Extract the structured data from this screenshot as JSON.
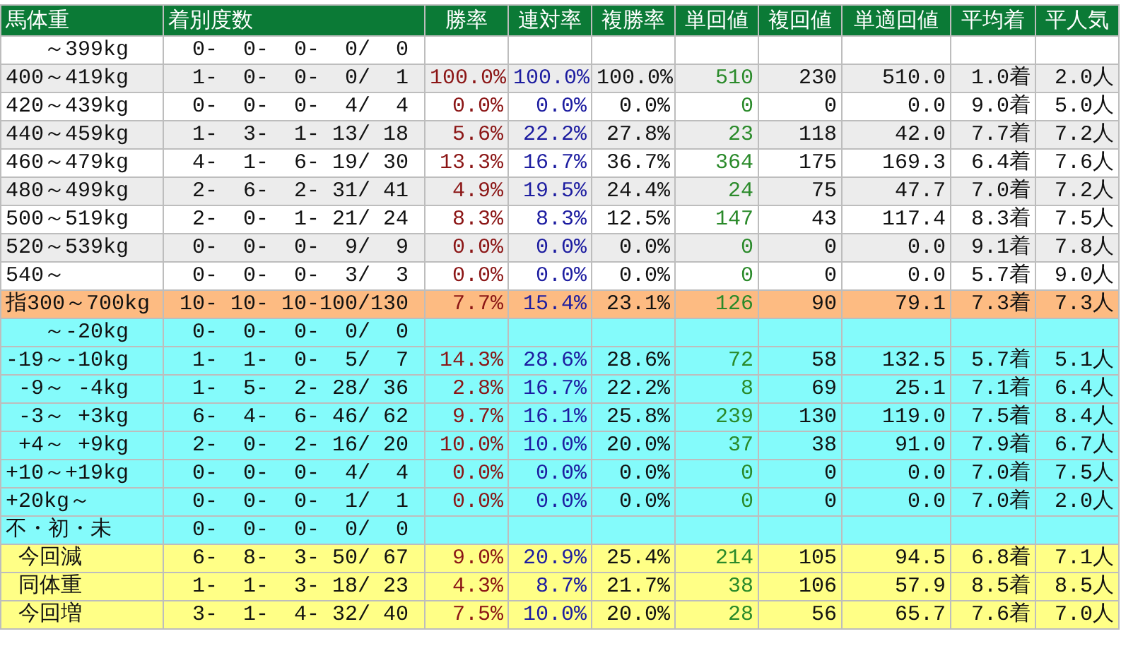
{
  "table": {
    "columns": [
      "馬体重",
      "着別度数",
      "勝率",
      "連対率",
      "複勝率",
      "単回値",
      "複回値",
      "単適回値",
      "平均着",
      "平人気"
    ],
    "rows": [
      {
        "kind": "weight",
        "label": "   ～399kg",
        "record": " 0-  0-  0-  0/  0"
      },
      {
        "kind": "weight",
        "label": "400～419kg",
        "record": " 1-  0-  0-  0/  1",
        "stats": [
          "100.0%",
          "100.0%",
          "100.0%",
          "510",
          "230",
          "510.0",
          "1.0着",
          "2.0人"
        ]
      },
      {
        "kind": "weight",
        "label": "420～439kg",
        "record": " 0-  0-  0-  4/  4",
        "stats": [
          "0.0%",
          "0.0%",
          "0.0%",
          "0",
          "0",
          "0.0",
          "9.0着",
          "5.0人"
        ]
      },
      {
        "kind": "weight",
        "label": "440～459kg",
        "record": " 1-  3-  1- 13/ 18",
        "stats": [
          "5.6%",
          "22.2%",
          "27.8%",
          "23",
          "118",
          "42.0",
          "7.7着",
          "7.2人"
        ]
      },
      {
        "kind": "weight",
        "label": "460～479kg",
        "record": " 4-  1-  6- 19/ 30",
        "stats": [
          "13.3%",
          "16.7%",
          "36.7%",
          "364",
          "175",
          "169.3",
          "6.4着",
          "7.6人"
        ]
      },
      {
        "kind": "weight",
        "label": "480～499kg",
        "record": " 2-  6-  2- 31/ 41",
        "stats": [
          "4.9%",
          "19.5%",
          "24.4%",
          "24",
          "75",
          "47.7",
          "7.0着",
          "7.2人"
        ]
      },
      {
        "kind": "weight",
        "label": "500～519kg",
        "record": " 2-  0-  1- 21/ 24",
        "stats": [
          "8.3%",
          "8.3%",
          "12.5%",
          "147",
          "43",
          "117.4",
          "8.3着",
          "7.5人"
        ]
      },
      {
        "kind": "weight",
        "label": "520～539kg",
        "record": " 0-  0-  0-  9/  9",
        "stats": [
          "0.0%",
          "0.0%",
          "0.0%",
          "0",
          "0",
          "0.0",
          "9.1着",
          "7.8人"
        ]
      },
      {
        "kind": "weight",
        "label": "540～",
        "record": " 0-  0-  0-  3/  3",
        "stats": [
          "0.0%",
          "0.0%",
          "0.0%",
          "0",
          "0",
          "0.0",
          "5.7着",
          "9.0人"
        ]
      },
      {
        "kind": "total",
        "label": "指300～700kg",
        "record": "10- 10- 10-100/130",
        "stats": [
          "7.7%",
          "15.4%",
          "23.1%",
          "126",
          "90",
          "79.1",
          "7.3着",
          "7.3人"
        ]
      },
      {
        "kind": "change",
        "label": "   ～-20kg",
        "record": " 0-  0-  0-  0/  0"
      },
      {
        "kind": "change",
        "label": "-19～-10kg",
        "record": " 1-  1-  0-  5/  7",
        "stats": [
          "14.3%",
          "28.6%",
          "28.6%",
          "72",
          "58",
          "132.5",
          "5.7着",
          "5.1人"
        ]
      },
      {
        "kind": "change",
        "label": " -9～ -4kg",
        "record": " 1-  5-  2- 28/ 36",
        "stats": [
          "2.8%",
          "16.7%",
          "22.2%",
          "8",
          "69",
          "25.1",
          "7.1着",
          "6.4人"
        ]
      },
      {
        "kind": "change",
        "label": " -3～ +3kg",
        "record": " 6-  4-  6- 46/ 62",
        "stats": [
          "9.7%",
          "16.1%",
          "25.8%",
          "239",
          "130",
          "119.0",
          "7.5着",
          "8.4人"
        ]
      },
      {
        "kind": "change",
        "label": " +4～ +9kg",
        "record": " 2-  0-  2- 16/ 20",
        "stats": [
          "10.0%",
          "10.0%",
          "20.0%",
          "37",
          "38",
          "91.0",
          "7.9着",
          "6.7人"
        ]
      },
      {
        "kind": "change",
        "label": "+10～+19kg",
        "record": " 0-  0-  0-  4/  4",
        "stats": [
          "0.0%",
          "0.0%",
          "0.0%",
          "0",
          "0",
          "0.0",
          "7.0着",
          "7.5人"
        ]
      },
      {
        "kind": "change",
        "label": "+20kg～",
        "record": " 0-  0-  0-  1/  1",
        "stats": [
          "0.0%",
          "0.0%",
          "0.0%",
          "0",
          "0",
          "0.0",
          "7.0着",
          "2.0人"
        ]
      },
      {
        "kind": "change",
        "label": "不・初・未",
        "record": " 0-  0-  0-  0/  0"
      },
      {
        "kind": "compare",
        "label": " 今回減",
        "record": " 6-  8-  3- 50/ 67",
        "stats": [
          "9.0%",
          "20.9%",
          "25.4%",
          "214",
          "105",
          "94.5",
          "6.8着",
          "7.1人"
        ]
      },
      {
        "kind": "compare",
        "label": " 同体重",
        "record": " 1-  1-  3- 18/ 23",
        "stats": [
          "4.3%",
          "8.7%",
          "21.7%",
          "38",
          "106",
          "57.9",
          "8.5着",
          "8.5人"
        ]
      },
      {
        "kind": "compare",
        "label": " 今回増",
        "record": " 3-  1-  4- 32/ 40",
        "stats": [
          "7.5%",
          "10.0%",
          "20.0%",
          "28",
          "56",
          "65.7",
          "7.6着",
          "7.0人"
        ]
      }
    ]
  }
}
